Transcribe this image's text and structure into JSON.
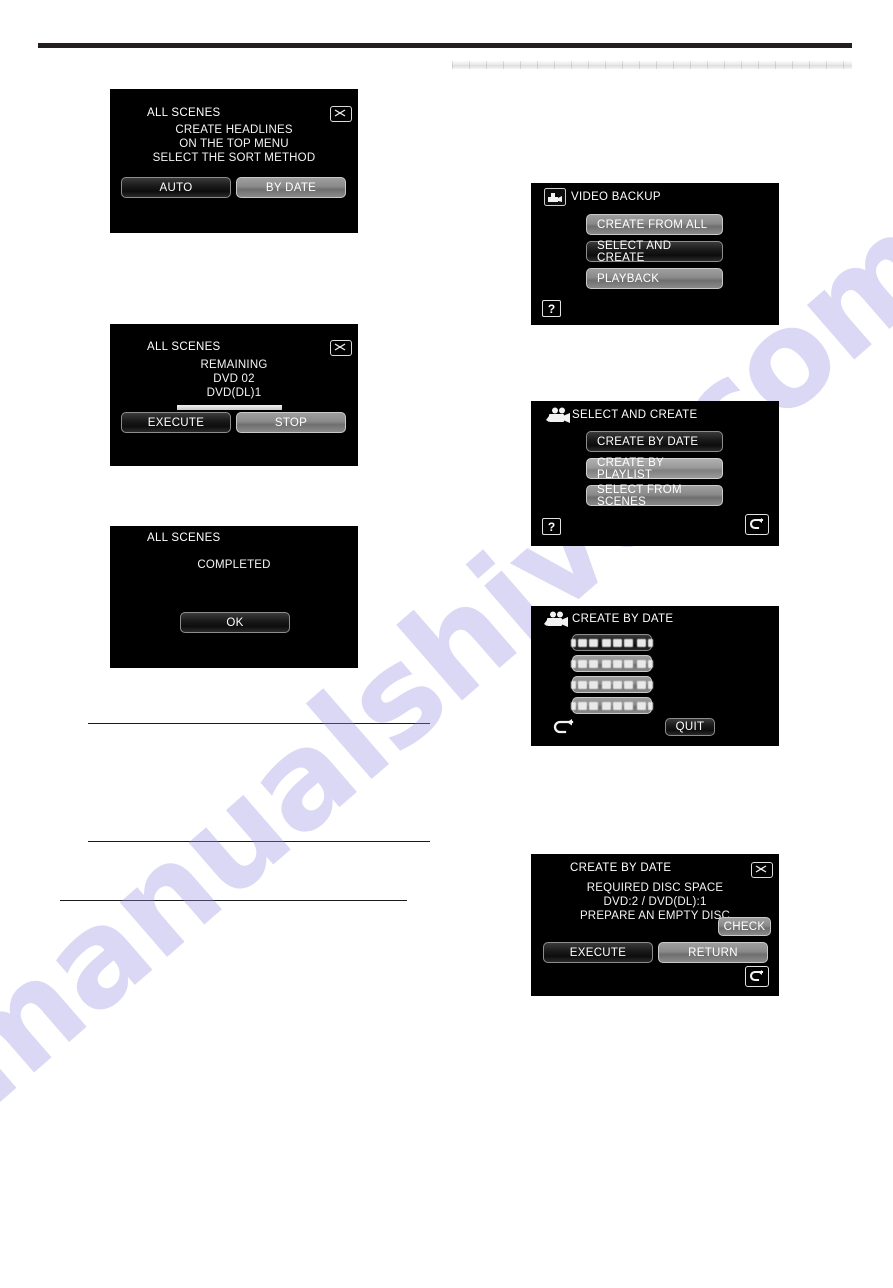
{
  "page": {
    "watermark": "manualshive.com",
    "watermark_color": "#928cde"
  },
  "panels": {
    "all_scenes_sort": {
      "title": "ALL SCENES",
      "message_lines": [
        "CREATE HEADLINES",
        "ON THE TOP MENU",
        "SELECT THE SORT METHOD"
      ],
      "close_icon": "close-x-icon",
      "buttons": [
        {
          "label": "AUTO",
          "style": "dark"
        },
        {
          "label": "BY DATE",
          "style": "grey"
        }
      ]
    },
    "all_scenes_remaining": {
      "title": "ALL SCENES",
      "message_lines": [
        "REMAINING",
        "DVD    02",
        "DVD(DL)1"
      ],
      "close_icon": "close-x-icon",
      "progress_percent": 100,
      "buttons": [
        {
          "label": "EXECUTE",
          "style": "dark"
        },
        {
          "label": "STOP",
          "style": "grey"
        }
      ]
    },
    "all_scenes_completed": {
      "title": "ALL SCENES",
      "message_lines": [
        "COMPLETED"
      ],
      "buttons": [
        {
          "label": "OK",
          "style": "dark"
        }
      ]
    },
    "video_backup": {
      "title": "VIDEO BACKUP",
      "title_icon": "video-camera-boxed-icon",
      "help_icon": "question-mark-icon",
      "buttons": [
        {
          "label": "CREATE FROM ALL",
          "style": "grey"
        },
        {
          "label": "SELECT AND CREATE",
          "style": "dark"
        },
        {
          "label": "PLAYBACK",
          "style": "grey"
        }
      ]
    },
    "select_and_create": {
      "title": "SELECT AND CREATE",
      "title_icon": "movie-camera-icon",
      "help_icon": "question-mark-icon",
      "return_icon": "return-arrow-icon",
      "buttons": [
        {
          "label": "CREATE BY DATE",
          "style": "dark"
        },
        {
          "label": "CREATE BY PLAYLIST",
          "style": "grey"
        },
        {
          "label": "SELECT FROM SCENES",
          "style": "grey"
        }
      ]
    },
    "create_by_date_list": {
      "title": "CREATE BY DATE",
      "title_icon": "movie-camera-icon",
      "back_icon": "back-arrow-icon",
      "date_items": [
        {
          "label": "",
          "style": "dark",
          "redacted": true
        },
        {
          "label": "",
          "style": "grey",
          "redacted": true
        },
        {
          "label": "",
          "style": "grey",
          "redacted": true
        },
        {
          "label": "",
          "style": "grey",
          "redacted": true
        }
      ],
      "quit_label": "QUIT"
    },
    "create_by_date_confirm": {
      "title": "CREATE BY DATE",
      "close_icon": "close-x-icon",
      "message_lines": [
        "REQUIRED DISC SPACE",
        "DVD:2 / DVD(DL):1",
        "PREPARE AN EMPTY DISC"
      ],
      "check_label": "CHECK",
      "return_icon": "return-arrow-icon",
      "buttons": [
        {
          "label": "EXECUTE",
          "style": "dark"
        },
        {
          "label": "RETURN",
          "style": "grey"
        }
      ]
    }
  }
}
